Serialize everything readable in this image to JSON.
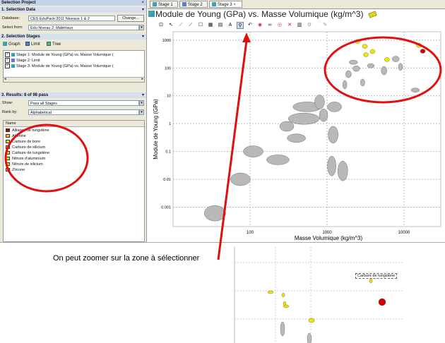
{
  "left_panel": {
    "header": "Selection Project",
    "close": "×",
    "selection_data": {
      "title": "1. Selection Data",
      "database_label": "Database:",
      "database_value": "CES EduPack 2011 Niveaux 1 & 2",
      "change_button": "Change...",
      "select_from_label": "Select from:",
      "select_from_value": "Edu Niveau 2: Matériaux"
    },
    "selection_stages": {
      "title": "2. Selection Stages",
      "toolbar": [
        "Graph",
        "Limit",
        "Tree"
      ],
      "stages": [
        "Stage 1: Module de Young (GPa) vs. Masse Volumique (",
        "Stage 2: Limit",
        "Stage 3: Module de Young (GPa) vs. Masse Volumique ("
      ]
    },
    "results": {
      "title": "3. Results: 8 of 98 pass",
      "show_label": "Show:",
      "show_value": "Pass all Stages",
      "rank_label": "Rank by:",
      "rank_value": "Alphabetical",
      "column_header": "Name",
      "items": [
        {
          "name": "Alliages de tungstène",
          "color": "#c00000"
        },
        {
          "name": "Alumine",
          "color": "#e8d400"
        },
        {
          "name": "Carbure de bore",
          "color": "#e8d400"
        },
        {
          "name": "Carbure de silicium",
          "color": "#e8d400"
        },
        {
          "name": "Carbure de tungstène",
          "color": "#e8d400"
        },
        {
          "name": "Nitrure d'aluminium",
          "color": "#e8d400"
        },
        {
          "name": "Nitrure de silicium",
          "color": "#e8d400"
        },
        {
          "name": "Zircone",
          "color": "#e8d400"
        }
      ]
    }
  },
  "tabs": [
    "Stage 1",
    "Stage 2",
    "Stage 3"
  ],
  "active_tab": "Stage 3",
  "chart_title": "Module de Young (GPa) vs. Masse Volumique (kg/m^3)",
  "chart_data": {
    "type": "scatter",
    "title": "Module de Young (GPa) vs. Masse Volumique (kg/m^3)",
    "xlabel": "Masse Volumique (kg/m^3)",
    "ylabel": "Module de Young (GPa)",
    "x_scale": "log",
    "y_scale": "log",
    "x_ticks": [
      "100",
      "1000",
      "10000"
    ],
    "y_ticks": [
      "1000",
      "100",
      "10",
      "1",
      "0.1",
      "0.01",
      "0.001"
    ],
    "grid": true,
    "series": [
      {
        "name": "gray",
        "color": "#b8b8b8",
        "points": [
          {
            "x": 35,
            "y": 0.0006
          },
          {
            "x": 75,
            "y": 0.01
          },
          {
            "x": 110,
            "y": 0.1
          },
          {
            "x": 230,
            "y": 0.05
          },
          {
            "x": 400,
            "y": 0.3
          },
          {
            "x": 300,
            "y": 0.8
          },
          {
            "x": 500,
            "y": 1.5
          },
          {
            "x": 550,
            "y": 4
          },
          {
            "x": 800,
            "y": 6
          },
          {
            "x": 900,
            "y": 2
          },
          {
            "x": 1200,
            "y": 0.4
          },
          {
            "x": 1250,
            "y": 4
          },
          {
            "x": 1150,
            "y": 0.03
          },
          {
            "x": 1600,
            "y": 0.02
          },
          {
            "x": 1700,
            "y": 25
          },
          {
            "x": 1900,
            "y": 60
          },
          {
            "x": 2200,
            "y": 160
          },
          {
            "x": 2400,
            "y": 95
          },
          {
            "x": 2900,
            "y": 30
          },
          {
            "x": 3700,
            "y": 120
          },
          {
            "x": 5500,
            "y": 80
          },
          {
            "x": 7800,
            "y": 210
          },
          {
            "x": 9000,
            "y": 110
          },
          {
            "x": 14000,
            "y": 16
          }
        ]
      },
      {
        "name": "yellow",
        "color": "#f2e600",
        "points": [
          {
            "x": 2500,
            "y": 900
          },
          {
            "x": 3100,
            "y": 600
          },
          {
            "x": 3200,
            "y": 300
          },
          {
            "x": 3900,
            "y": 390
          },
          {
            "x": 6000,
            "y": 200
          },
          {
            "x": 15600,
            "y": 650
          }
        ]
      },
      {
        "name": "red",
        "color": "#d40000",
        "points": [
          {
            "x": 17500,
            "y": 400
          }
        ]
      }
    ]
  },
  "caption": "On peut zoomer sur la zone à sélectionner",
  "zoom_label": "Carbure de tungstène"
}
